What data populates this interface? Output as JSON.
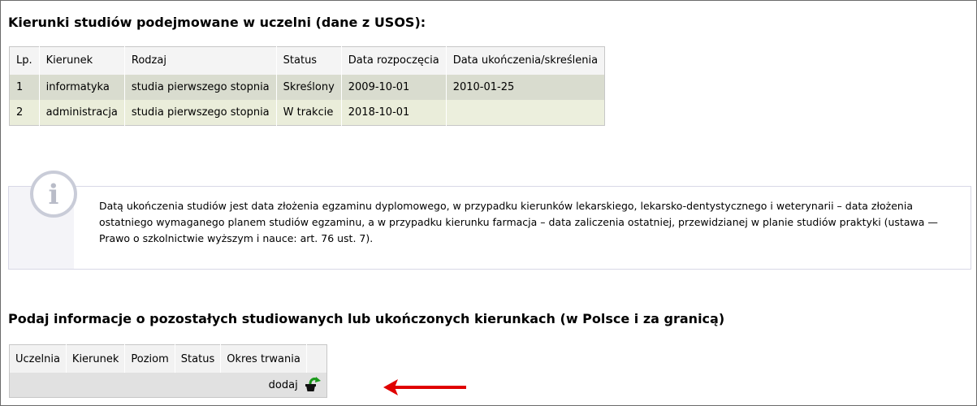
{
  "section1": {
    "title": "Kierunki studiów podejmowane w uczelni (dane z USOS):",
    "headers": [
      "Lp.",
      "Kierunek",
      "Rodzaj",
      "Status",
      "Data rozpoczęcia",
      "Data ukończenia/skreślenia"
    ],
    "rows": [
      [
        "1",
        "informatyka",
        "studia pierwszego stopnia",
        "Skreślony",
        "2009-10-01",
        "2010-01-25"
      ],
      [
        "2",
        "administracja",
        "studia pierwszego stopnia",
        "W trakcie",
        "2018-10-01",
        ""
      ]
    ]
  },
  "info": {
    "icon": "info-icon",
    "icon_glyph": "i",
    "text": "Datą ukończenia studiów jest data złożenia egzaminu dyplomowego, w przypadku kierunków lekarskiego, lekarsko-dentystycznego i weterynarii – data złożenia ostatniego wymaganego planem studiów egzaminu, a w przypadku kierunku farmacja – data zaliczenia ostatniej, przewidzianej w planie studiów praktyki (ustawa — Prawo o szkolnictwie wyższym i nauce: art. 76 ust. 7)."
  },
  "section2": {
    "title": "Podaj informacje o pozostałych studiowanych lub ukończonych kierunkach (w Polsce i za granicą)",
    "headers": [
      "Uczelnia",
      "Kierunek",
      "Poziom",
      "Status",
      "Okres trwania"
    ],
    "add_label": "dodaj",
    "add_icon": "add-item-icon"
  },
  "annotation": {
    "arrow_color": "#e00000"
  }
}
